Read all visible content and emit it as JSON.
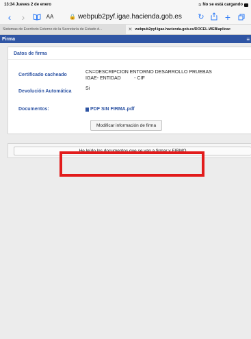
{
  "status_bar": {
    "time_date": "13:34  Jueves 2 de enero",
    "right_text": "No se está cargando"
  },
  "toolbar": {
    "back_icon": "chevron-left",
    "forward_icon": "chevron-right",
    "bookmarks_icon": "book",
    "text_size_label": "AA",
    "url": "webpub2pyf.igae.hacienda.gob.es",
    "reload_icon": "reload",
    "share_icon": "share",
    "new_tab_label": "+",
    "tabs_icon": "tabs"
  },
  "tabs": [
    {
      "label": "Sistemas de Escritorio Externo de la Secretaría de Estado d..."
    },
    {
      "label": "webpub2pyf.igae.hacienda.gob.es/DOCEL-WEB/aplicac"
    }
  ],
  "app_header": {
    "title": "Firma",
    "menu_icon": "hamburger"
  },
  "panel": {
    "title": "Datos de firma",
    "certificado_label": "Certificado cacheado",
    "certificado_line1": "CN=DESCRIPCION ENTORNO DESARROLLO PRUEBAS",
    "certificado_line2": "IGAE- ENTIDAD          - CIF",
    "devolucion_label": "Devolución Automática",
    "devolucion_value": "Si",
    "documentos_label": "Documentos:",
    "documento_link": "PDF SIN FIRMA.pdf",
    "modify_button": "Modificar información de firma"
  },
  "sign": {
    "button_label": "He leído los documentos que se van a firmar y FIRMO"
  },
  "colors": {
    "accent": "#2f55a4",
    "highlight": "#e21b1b",
    "safari_blue": "#2f7cf6"
  }
}
